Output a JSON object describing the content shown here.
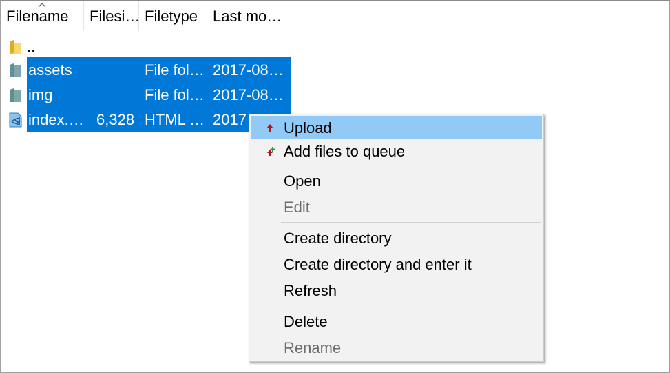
{
  "columns": [
    "Filename",
    "Filesi…",
    "Filetype",
    "Last mo…"
  ],
  "rows": [
    {
      "name": "..",
      "size": "",
      "type": "",
      "modified": "",
      "icon": "folder-icon",
      "selected": false
    },
    {
      "name": "assets",
      "size": "",
      "type": "File fol…",
      "modified": "2017-08…",
      "icon": "folder-icon",
      "selected": true
    },
    {
      "name": "img",
      "size": "",
      "type": "File fol…",
      "modified": "2017-08…",
      "icon": "folder-icon",
      "selected": true
    },
    {
      "name": "index.…",
      "size": "6,328",
      "type": "HTML …",
      "modified": "2017",
      "icon": "vscode-file-icon",
      "selected": true
    }
  ],
  "context_menu": {
    "items": [
      {
        "label": "Upload",
        "icon": "upload-arrow-icon",
        "highlighted": true,
        "disabled": false
      },
      {
        "label": "Add files to queue",
        "icon": "add-to-queue-icon",
        "highlighted": false,
        "disabled": false
      },
      {
        "label": "Open",
        "highlighted": false,
        "disabled": false
      },
      {
        "label": "Edit",
        "highlighted": false,
        "disabled": true
      },
      {
        "label": "Create directory",
        "highlighted": false,
        "disabled": false
      },
      {
        "label": "Create directory and enter it",
        "highlighted": false,
        "disabled": false
      },
      {
        "label": "Refresh",
        "highlighted": false,
        "disabled": false
      },
      {
        "label": "Delete",
        "highlighted": false,
        "disabled": false
      },
      {
        "label": "Rename",
        "highlighted": false,
        "disabled": true
      }
    ]
  },
  "colors": {
    "selection": "#0078d7",
    "menu_highlight": "#91c9f7",
    "menu_background": "#f2f2f2",
    "disabled_text": "#6d6d6d"
  }
}
